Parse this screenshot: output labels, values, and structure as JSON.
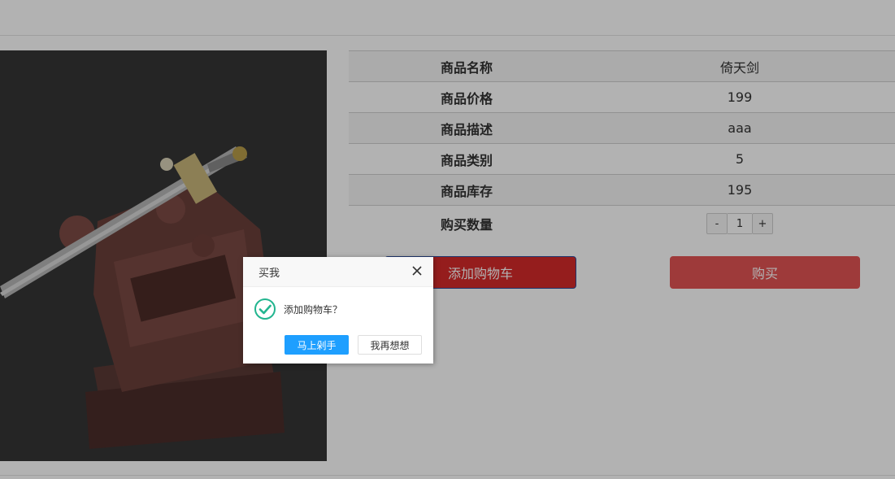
{
  "product": {
    "image_alt": "倚天剑",
    "rows": [
      {
        "label": "商品名称",
        "value": "倚天剑"
      },
      {
        "label": "商品价格",
        "value": "199"
      },
      {
        "label": "商品描述",
        "value": "aaa"
      },
      {
        "label": "商品类别",
        "value": "5"
      },
      {
        "label": "商品库存",
        "value": "195"
      }
    ],
    "quantity": {
      "label": "购买数量",
      "minus": "-",
      "value": "1",
      "plus": "+"
    }
  },
  "actions": {
    "add_to_cart": "添加购物车",
    "buy": "购买"
  },
  "dialog": {
    "title": "买我",
    "message": "添加购物车？",
    "confirm": "马上剁手",
    "cancel": "我再想想"
  },
  "colors": {
    "cart_button": "#d62a2a",
    "buy_button": "#e35353",
    "confirm_button": "#1e9fff",
    "success_icon": "#22b58f"
  },
  "icons": {
    "close": "close-icon",
    "success": "check-circle-icon"
  }
}
